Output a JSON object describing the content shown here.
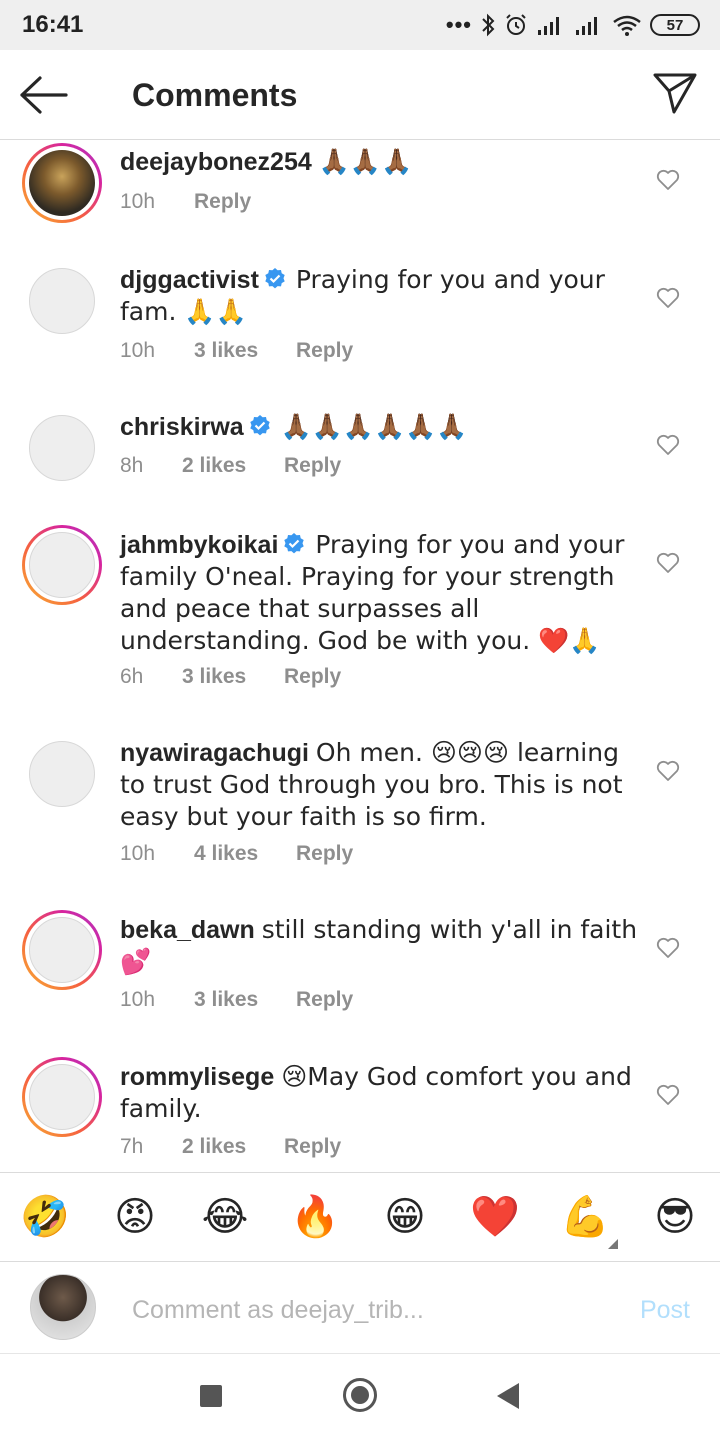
{
  "status_bar": {
    "time": "16:41",
    "battery": "57"
  },
  "header": {
    "title": "Comments"
  },
  "comments": [
    {
      "username": "deejaybonez254",
      "text": "🙏🏾🙏🏾🙏🏾",
      "time": "10h",
      "likes": "",
      "reply": "Reply"
    },
    {
      "username": "djggactivist",
      "text": "Praying for you and your fam. 🙏🙏",
      "time": "10h",
      "likes": "3 likes",
      "reply": "Reply"
    },
    {
      "username": "chriskirwa",
      "text": "🙏🏾🙏🏾🙏🏾🙏🏾🙏🏾🙏🏾",
      "time": "8h",
      "likes": "2 likes",
      "reply": "Reply"
    },
    {
      "username": "jahmbykoikai",
      "text": "Praying for you and your family O'neal. Praying for your strength and peace that surpasses all understanding. God be with you. ❤️🙏",
      "time": "6h",
      "likes": "3 likes",
      "reply": "Reply"
    },
    {
      "username": "nyawiragachugi",
      "text": "Oh men. 😢😢😢 learning to trust God through you bro. This is not easy but your faith is so firm.",
      "time": "10h",
      "likes": "4 likes",
      "reply": "Reply"
    },
    {
      "username": "beka_dawn",
      "text": "still standing with y'all in faith 💕",
      "time": "10h",
      "likes": "3 likes",
      "reply": "Reply"
    },
    {
      "username": "rommylisege",
      "text": "😢May God comfort you and family.",
      "time": "7h",
      "likes": "2 likes",
      "reply": "Reply"
    }
  ],
  "emoji_bar": [
    "🤣",
    "😡",
    "😂",
    "🔥",
    "😁",
    "❤️",
    "💪",
    "😎"
  ],
  "composer": {
    "placeholder": "Comment as deejay_trib...",
    "post_label": "Post"
  },
  "colors": {
    "accent": "#0095f6",
    "post_disabled": "#b2dffc",
    "verified": "#3897f0",
    "muted": "#8e8e8e"
  }
}
